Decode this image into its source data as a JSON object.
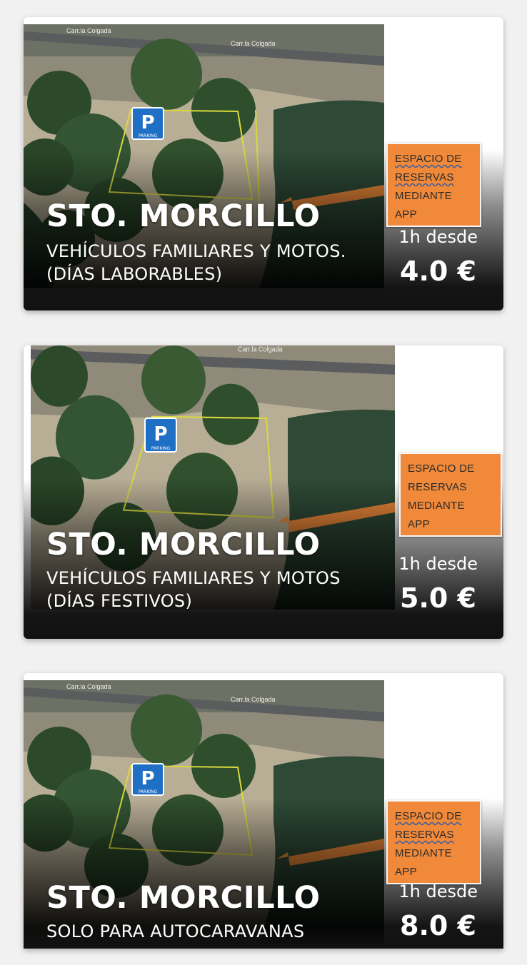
{
  "colors": {
    "badge": "#f0893a",
    "background": "#f1f1f1",
    "card": "#ffffff"
  },
  "map_labels": {
    "road": "Carr.la Colgada",
    "parking_letter": "P",
    "parking_word": "PARKING"
  },
  "cards": [
    {
      "title": "STO. MORCILLO",
      "subtitle": "VEHÍCULOS FAMILIARES Y MOTOS.\n(DÍAS LABORABLES)",
      "price_label": "1h desde",
      "price": "4.0 €",
      "badge": [
        "ESPACIO DE",
        "RESERVAS",
        "MEDIANTE",
        "APP"
      ]
    },
    {
      "title": "STO. MORCILLO",
      "subtitle": "VEHÍCULOS FAMILIARES Y MOTOS\n(DÍAS FESTIVOS)",
      "price_label": "1h desde",
      "price": "5.0 €",
      "badge": [
        "ESPACIO DE",
        "RESERVAS",
        "MEDIANTE",
        "APP"
      ]
    },
    {
      "title": "STO. MORCILLO",
      "subtitle": "SOLO PARA AUTOCARAVANAS",
      "price_label": "1h desde",
      "price": "8.0 €",
      "badge": [
        "ESPACIO DE",
        "RESERVAS",
        "MEDIANTE",
        "APP"
      ]
    }
  ]
}
